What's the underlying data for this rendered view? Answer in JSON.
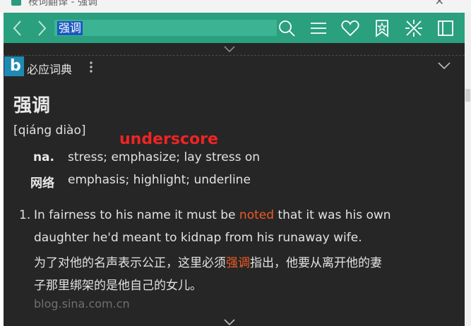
{
  "titlebar": {
    "title": "桉词翻译 - 强调"
  },
  "toolbar": {
    "search_value": "强调",
    "icons": [
      "back-icon",
      "forward-icon",
      "search-icon",
      "menu-icon",
      "heart-icon",
      "bookmark-icon",
      "tools-icon",
      "panel-icon"
    ]
  },
  "dictionary": {
    "name": "必应词典"
  },
  "entry": {
    "headword": "强调",
    "pinyin": "[qiáng diào]",
    "definitions": [
      {
        "pos": "na.",
        "meaning": "stress; emphasize; lay stress on"
      },
      {
        "pos": "网络",
        "meaning": "emphasis; highlight; underline"
      }
    ]
  },
  "overlay": {
    "text": "underscore"
  },
  "example": {
    "number": "1.",
    "en_before": "In fairness to his name it must be ",
    "en_highlight": "noted",
    "en_after": " that it was his own",
    "en_line2": "daughter he'd meant to kidnap from his runaway wife.",
    "zh_before": "为了对他的名声表示公正，这里必须",
    "zh_highlight": "强调",
    "zh_after": "指出，他要从离开他的妻",
    "zh_line2": "子那里绑架的是他自己的女儿。",
    "source": "blog.sina.com.cn"
  },
  "colors": {
    "toolbar_bg": "#2aa07f",
    "content_bg": "#262626",
    "highlight": "#f05a24",
    "overlay_text": "#ee2424",
    "selection": "#1a58c0"
  }
}
